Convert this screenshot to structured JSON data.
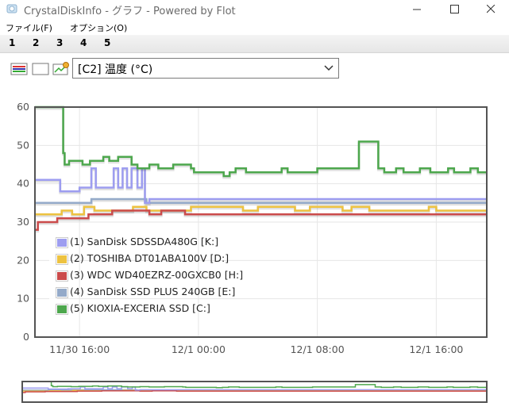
{
  "window": {
    "title": "CrystalDiskInfo - グラフ - Powered by Flot",
    "minimize_icon": "minimize-icon",
    "maximize_icon": "maximize-icon",
    "close_icon": "close-icon"
  },
  "menu": {
    "items": [
      "ファイル(F)",
      "オプション(O)"
    ]
  },
  "tabs": [
    "1",
    "2",
    "3",
    "4",
    "5"
  ],
  "toolbar": {
    "icons": [
      "select-all-icon",
      "select-none-icon",
      "settings-icon"
    ],
    "metric_select": "[C2] 温度 (°C)"
  },
  "colors": {
    "sandisk_480": "#9d9df0",
    "toshiba": "#edc240",
    "wdc": "#cb4b4b",
    "sandisk_240": "#94aac9",
    "kioxia": "#4da74d",
    "grid": "#e6e6e6"
  },
  "chart_data": {
    "type": "line",
    "ylim": [
      0,
      60
    ],
    "yticks": [
      "0",
      "10",
      "20",
      "30",
      "40",
      "50",
      "60"
    ],
    "xticks": [
      "11/30 16:00",
      "12/1 00:00",
      "12/1 08:00",
      "12/1 16:00"
    ],
    "x_tick_hours": [
      3,
      11,
      19,
      27
    ],
    "x_range_hours": [
      0,
      30.4
    ],
    "grid": true,
    "legend_position": "bottom-left",
    "series": [
      {
        "name": "(1) SanDisk SDSSDA480G [K:]",
        "color": "#9d9df0",
        "x": [
          0,
          1.7,
          1.7,
          3,
          3,
          3.8,
          3.8,
          4.1,
          4.1,
          5.3,
          5.3,
          5.6,
          5.6,
          5.9,
          5.9,
          6.2,
          6.2,
          6.5,
          6.5,
          6.9,
          6.9,
          7.2,
          7.2,
          7.4,
          7.4,
          7.7,
          7.7,
          30.4
        ],
        "y": [
          41,
          41,
          38,
          38,
          39,
          39,
          44,
          44,
          39,
          39,
          44,
          44,
          39,
          39,
          44,
          44,
          39,
          39,
          44,
          44,
          39,
          39,
          44,
          44,
          35,
          35,
          36,
          36
        ]
      },
      {
        "name": "(2) TOSHIBA DT01ABA100V [D:]",
        "color": "#edc240",
        "x": [
          0,
          1.8,
          1.8,
          2.5,
          2.5,
          3.3,
          3.3,
          4,
          4,
          6.6,
          6.6,
          7.5,
          7.5,
          10.5,
          10.5,
          14,
          14,
          15,
          15,
          17.5,
          17.5,
          18.5,
          18.5,
          20.7,
          20.7,
          21.3,
          21.3,
          22.5,
          22.5,
          26.5,
          26.5,
          27,
          27,
          30.4
        ],
        "y": [
          32,
          32,
          33,
          33,
          32,
          32,
          34,
          34,
          33,
          33,
          34,
          34,
          33,
          33,
          34,
          34,
          33,
          33,
          34,
          34,
          33,
          33,
          34,
          34,
          33,
          33,
          34,
          34,
          33,
          33,
          34,
          34,
          33,
          33
        ]
      },
      {
        "name": "(3) WDC WD40EZRZ-00GXCB0 [H:]",
        "color": "#cb4b4b",
        "x": [
          0,
          0.2,
          0.2,
          1.5,
          1.5,
          3.6,
          3.6,
          5.2,
          5.2,
          7.7,
          7.7,
          8.5,
          8.5,
          10.1,
          10.1,
          11.5,
          11.5,
          30.4
        ],
        "y": [
          28,
          28,
          30,
          30,
          31,
          31,
          32,
          32,
          33,
          33,
          32,
          32,
          33,
          33,
          32,
          32,
          32,
          32
        ]
      },
      {
        "name": "(4) SanDisk SSD PLUS 240GB [E:]",
        "color": "#94aac9",
        "x": [
          0,
          3.8,
          3.8,
          7.5,
          7.5,
          14.5,
          14.5,
          30.4
        ],
        "y": [
          35,
          35,
          36,
          36,
          35,
          35,
          35,
          35
        ]
      },
      {
        "name": "(5) KIOXIA-EXCERIA SSD [C:]",
        "color": "#4da74d",
        "x": [
          0,
          1.9,
          1.9,
          2,
          2,
          2.3,
          2.3,
          3.2,
          3.2,
          3.7,
          3.7,
          4.6,
          4.6,
          5,
          5,
          5.6,
          5.6,
          6.5,
          6.5,
          6.9,
          6.9,
          7.7,
          7.7,
          8.3,
          8.3,
          9.3,
          9.3,
          10.5,
          10.5,
          10.7,
          10.7,
          12.7,
          12.7,
          13.1,
          13.1,
          13.5,
          13.5,
          14.2,
          14.2,
          16.6,
          16.6,
          17,
          17,
          18.5,
          18.5,
          19,
          19,
          21.8,
          21.8,
          23.1,
          23.1,
          23.5,
          23.5,
          24.3,
          24.3,
          24.8,
          24.8,
          25.9,
          25.9,
          26.6,
          26.6,
          27.8,
          27.8,
          28.2,
          28.2,
          29.3,
          29.3,
          29.8,
          29.8,
          30.4
        ],
        "y": [
          60,
          60,
          48,
          48,
          45,
          45,
          46,
          46,
          45,
          45,
          46,
          46,
          47,
          47,
          46,
          46,
          47,
          47,
          45,
          45,
          44,
          44,
          45,
          45,
          44,
          44,
          45,
          45,
          44,
          44,
          43,
          43,
          42,
          42,
          43,
          43,
          44,
          44,
          43,
          43,
          44,
          44,
          43,
          43,
          43,
          43,
          44,
          44,
          51,
          51,
          44,
          44,
          43,
          43,
          44,
          44,
          43,
          43,
          44,
          44,
          43,
          43,
          44,
          44,
          43,
          43,
          44,
          44,
          43,
          43
        ]
      }
    ]
  }
}
